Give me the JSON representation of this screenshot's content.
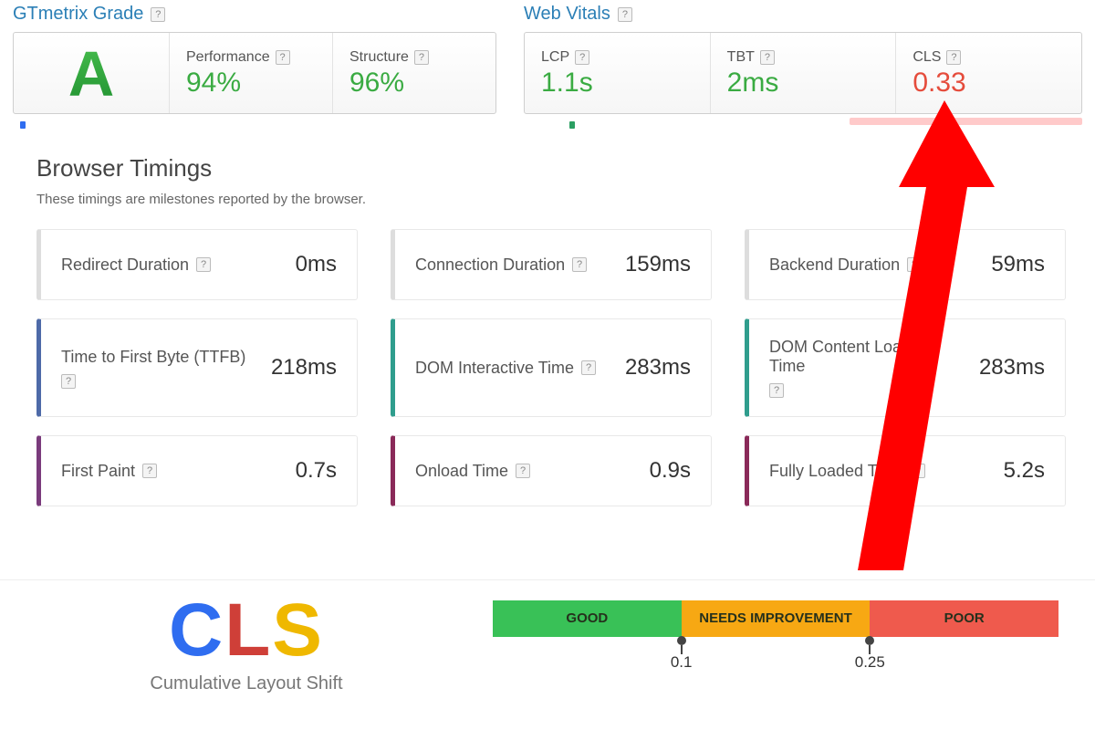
{
  "grade": {
    "heading": "GTmetrix Grade",
    "letter": "A",
    "performance": {
      "label": "Performance",
      "value": "94%"
    },
    "structure": {
      "label": "Structure",
      "value": "96%"
    }
  },
  "vitals": {
    "heading": "Web Vitals",
    "lcp": {
      "label": "LCP",
      "value": "1.1s",
      "status": "green"
    },
    "tbt": {
      "label": "TBT",
      "value": "2ms",
      "status": "green"
    },
    "cls": {
      "label": "CLS",
      "value": "0.33",
      "status": "red"
    }
  },
  "help_glyph": "?",
  "browser_timings": {
    "title": "Browser Timings",
    "subtitle": "These timings are milestones reported by the browser.",
    "cards": [
      {
        "label": "Redirect Duration",
        "value": "0ms",
        "accent": "gray"
      },
      {
        "label": "Connection Duration",
        "value": "159ms",
        "accent": "gray"
      },
      {
        "label": "Backend Duration",
        "value": "59ms",
        "accent": "gray"
      },
      {
        "label": "Time to First Byte (TTFB)",
        "value": "218ms",
        "accent": "blue"
      },
      {
        "label": "DOM Interactive Time",
        "value": "283ms",
        "accent": "teal"
      },
      {
        "label": "DOM Content Loaded Time",
        "value": "283ms",
        "accent": "teal"
      },
      {
        "label": "First Paint",
        "value": "0.7s",
        "accent": "purple"
      },
      {
        "label": "Onload Time",
        "value": "0.9s",
        "accent": "plum"
      },
      {
        "label": "Fully Loaded Time",
        "value": "5.2s",
        "accent": "plum"
      }
    ]
  },
  "cls_footer": {
    "abbrev": "CLS",
    "full": "Cumulative Layout Shift",
    "scale": {
      "good": {
        "label": "GOOD"
      },
      "ni": {
        "label": "NEEDS IMPROVEMENT"
      },
      "poor": {
        "label": "POOR"
      },
      "thresholds": [
        "0.1",
        "0.25"
      ]
    }
  }
}
